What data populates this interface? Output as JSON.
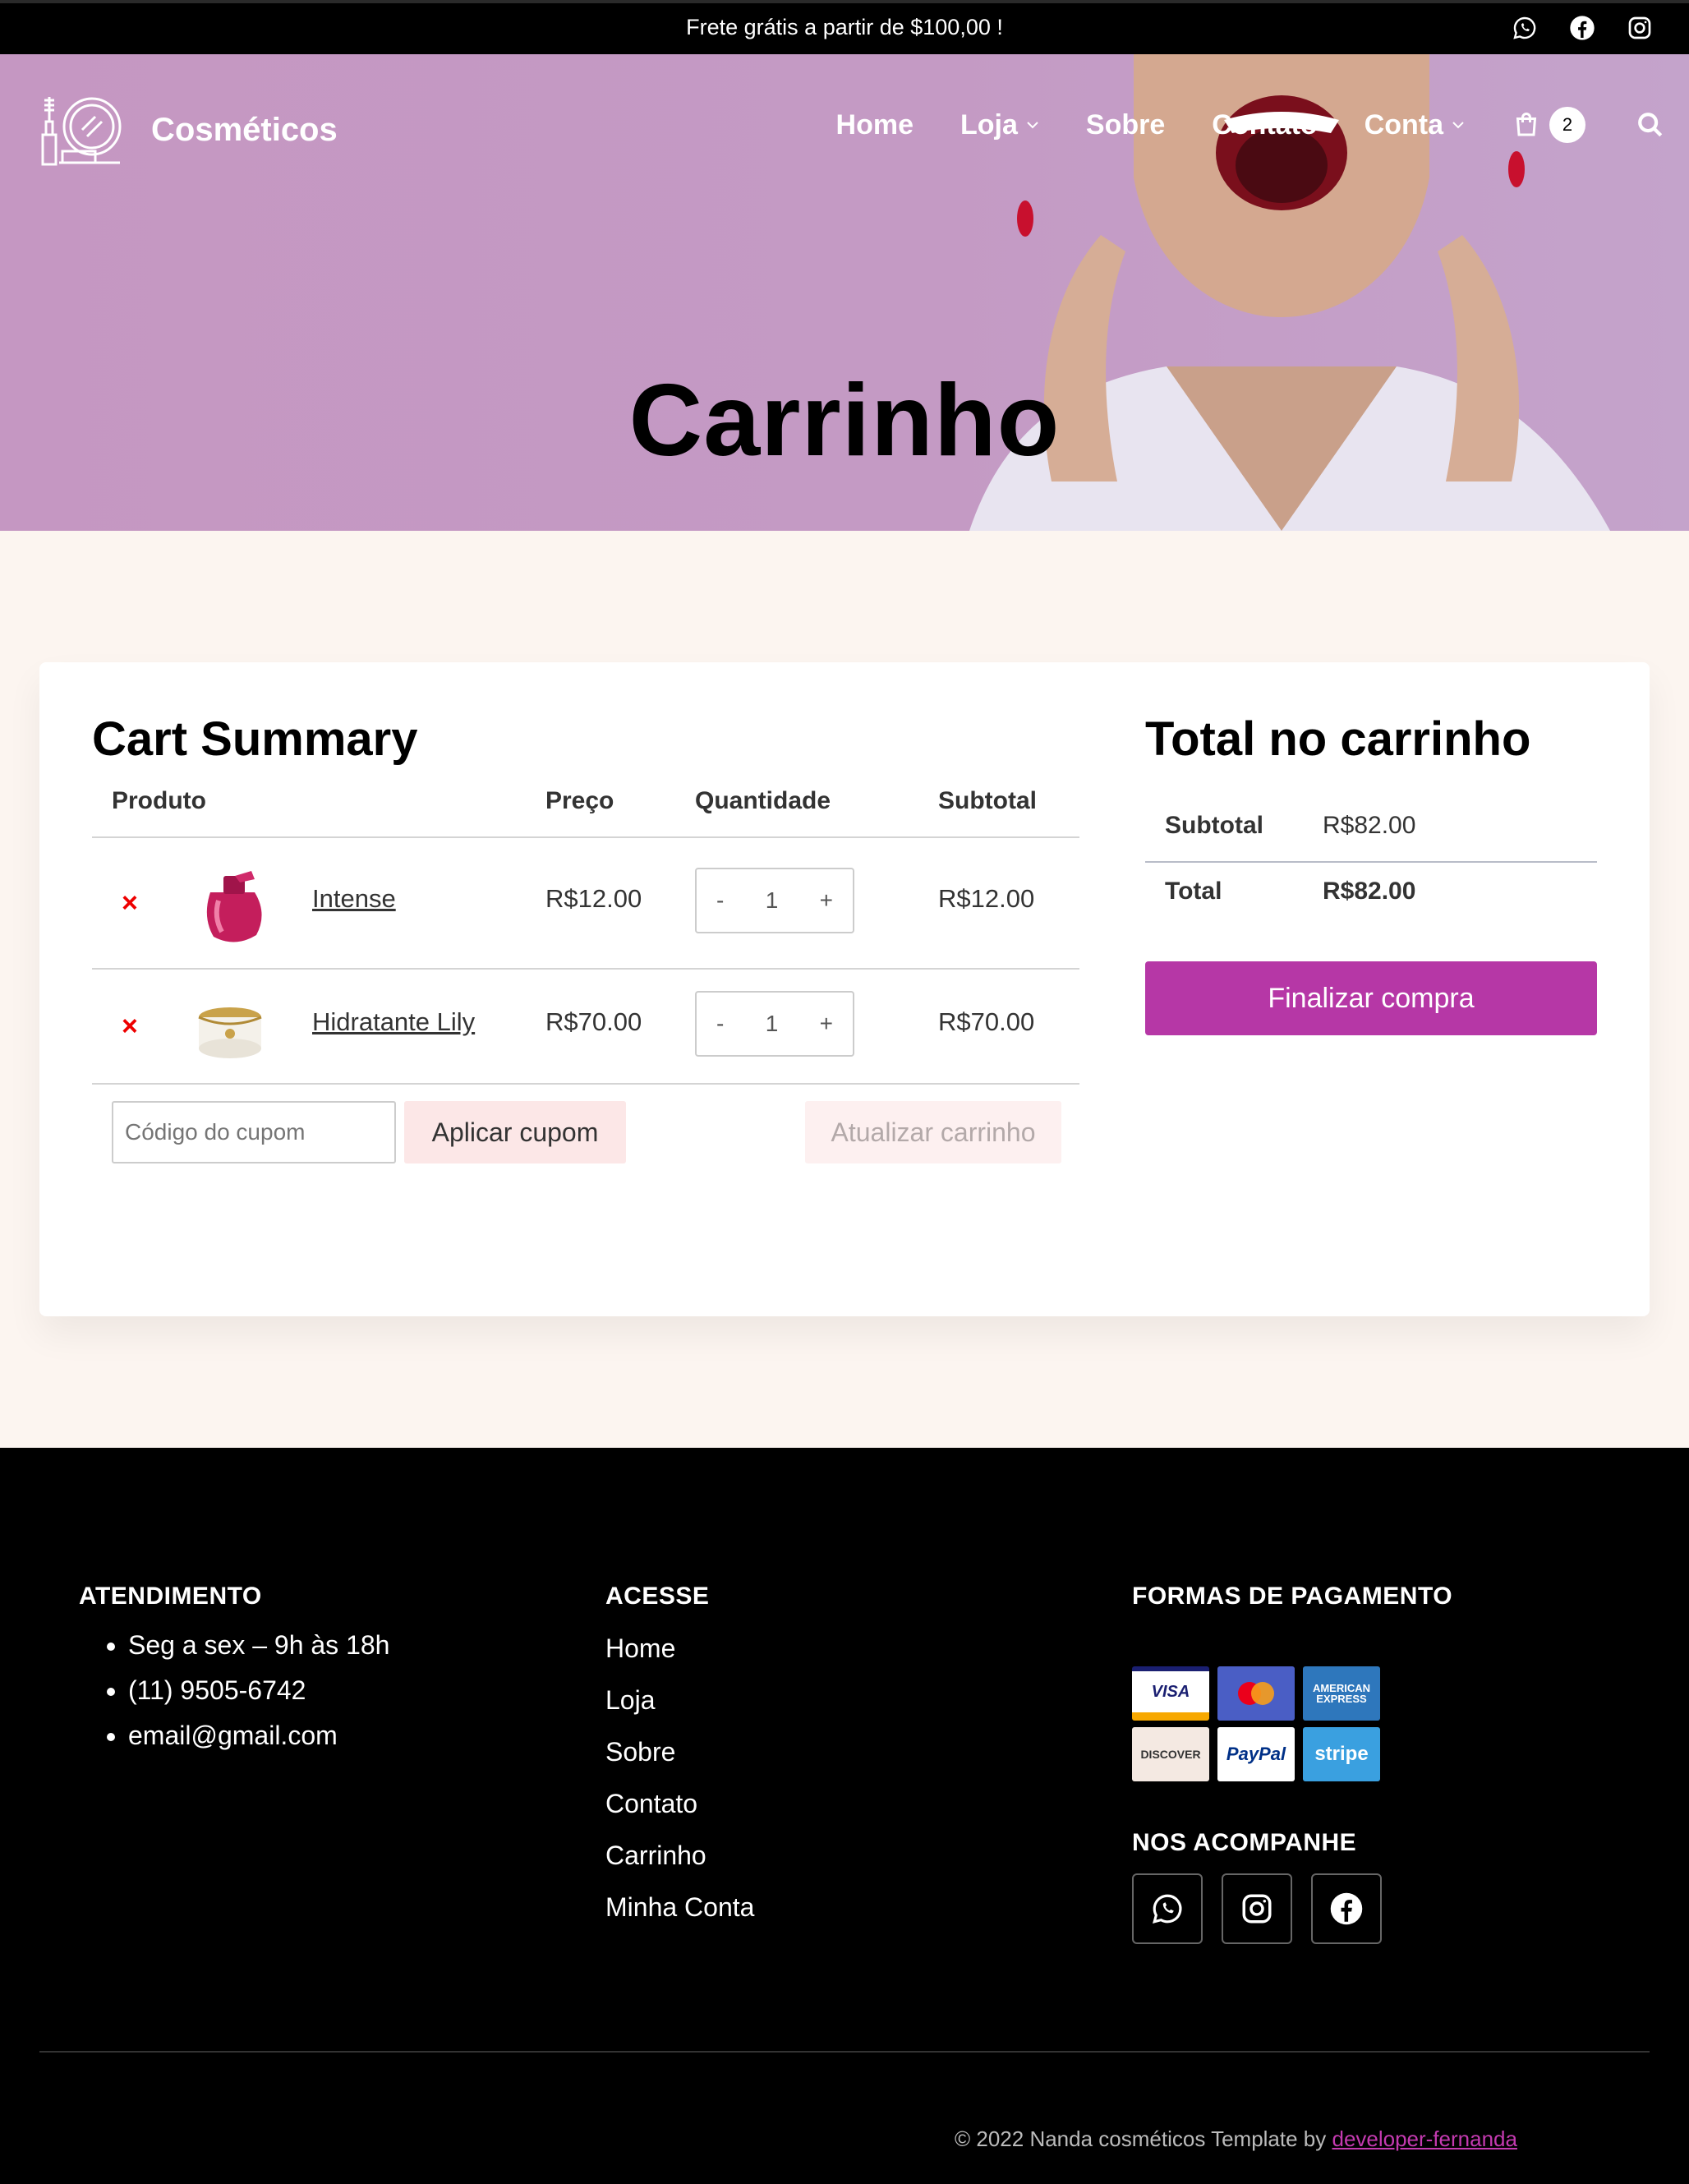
{
  "topbar": {
    "message": "Frete grátis a partir de $100,00 !",
    "social_icons": [
      "whatsapp-icon",
      "facebook-icon",
      "instagram-icon"
    ]
  },
  "brand": {
    "name": "Cosméticos"
  },
  "nav": {
    "items": [
      {
        "label": "Home",
        "dropdown": false
      },
      {
        "label": "Loja",
        "dropdown": true
      },
      {
        "label": "Sobre",
        "dropdown": false
      },
      {
        "label": "Contato",
        "dropdown": false
      },
      {
        "label": "Conta",
        "dropdown": true
      }
    ],
    "cart_count": "2"
  },
  "hero": {
    "title": "Carrinho"
  },
  "cart": {
    "title": "Cart Summary",
    "columns": [
      "Produto",
      "Preço",
      "Quantidade",
      "Subtotal"
    ],
    "remove_symbol": "×",
    "rows": [
      {
        "name": "Intense",
        "price": "R$12.00",
        "qty": "1",
        "subtotal": "R$12.00",
        "minus": "-",
        "plus": "+"
      },
      {
        "name": "Hidratante Lily",
        "price": "R$70.00",
        "qty": "1",
        "subtotal": "R$70.00",
        "minus": "-",
        "plus": "+"
      }
    ],
    "coupon_placeholder": "Código do cupom",
    "apply_coupon": "Aplicar cupom",
    "update_cart": "Atualizar carrinho"
  },
  "totals": {
    "title": "Total no carrinho",
    "subtotal_label": "Subtotal",
    "subtotal_value": "R$82.00",
    "total_label": "Total",
    "total_value": "R$82.00",
    "checkout": "Finalizar compra"
  },
  "footer": {
    "atendimento_title": "ATENDIMENTO",
    "atendimento": [
      "Seg a sex – 9h às 18h",
      "(11) 9505-6742",
      "email@gmail.com"
    ],
    "acesse_title": "ACESSE",
    "links": [
      "Home",
      "Loja",
      "Sobre",
      "Contato",
      "Carrinho",
      "Minha Conta"
    ],
    "payment_title": "FORMAS DE PAGAMENTO",
    "payments": [
      {
        "label": "VISA",
        "color": "#1a1f71"
      },
      {
        "label": "",
        "color": "#eb001b"
      },
      {
        "label": "AMERICAN EXPRESS",
        "color": "#2e77bc"
      },
      {
        "label": "DISCOVER",
        "color": "#333333"
      },
      {
        "label": "PayPal",
        "color": "#003087"
      },
      {
        "label": "stripe",
        "color": "#ffffff"
      }
    ],
    "follow_title": "NOS ACOMPANHE",
    "follow_icons": [
      "whatsapp-icon",
      "instagram-icon",
      "facebook-icon"
    ],
    "copyright": "© 2022 Nanda cosméticos Template by ",
    "credit_link": "developer-fernanda"
  },
  "colors": {
    "accent": "#b637a6",
    "hero_bg": "#c597c2",
    "page_bg": "#fcf5f0",
    "remove": "#e00000"
  }
}
